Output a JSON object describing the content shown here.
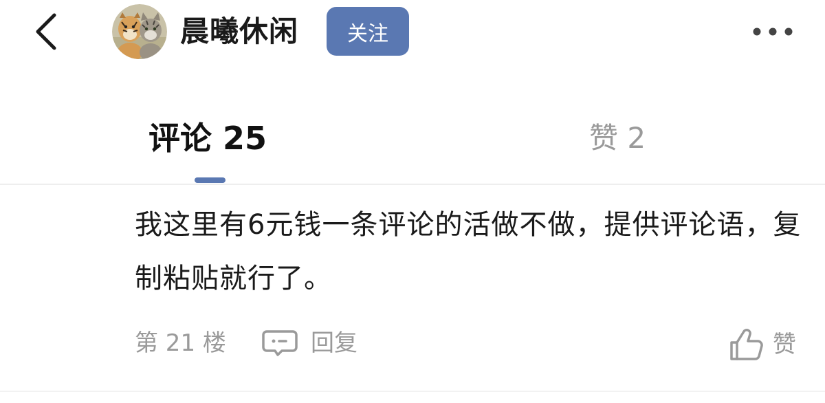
{
  "header": {
    "back_icon": "chevron-left-icon",
    "avatar_icon": "tiger-avatar",
    "channel_name": "晨曦休闲",
    "follow_label": "关注",
    "more_icon": "more-horizontal-icon",
    "accent_color": "#5a78b2"
  },
  "tabs": {
    "comments_label": "评论 25",
    "likes_label": "赞 2",
    "active": "comments"
  },
  "comment": {
    "text": "我这里有6元钱一条评论的活做不做，提供评论语，复制粘贴就行了。",
    "floor": "第 21 楼",
    "reply_icon": "comment-bubble-icon",
    "reply_label": "回复",
    "like_icon": "thumbs-up-icon",
    "like_label": "赞"
  }
}
